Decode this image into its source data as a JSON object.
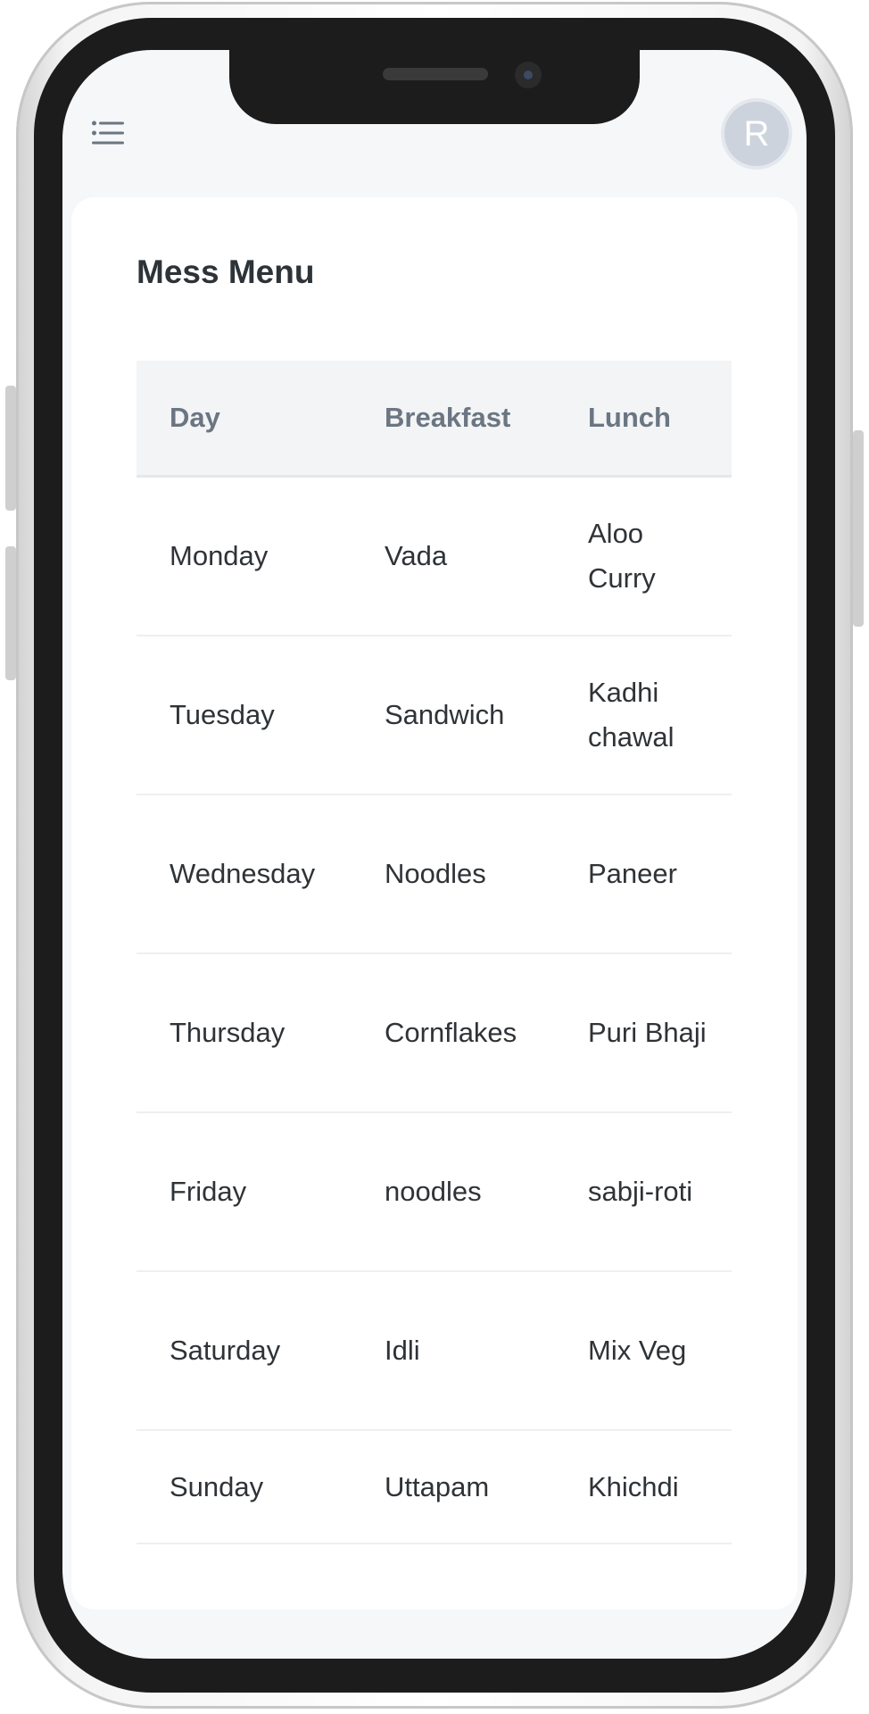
{
  "header": {
    "avatar_initial": "R"
  },
  "page": {
    "title": "Mess Menu"
  },
  "table": {
    "columns": [
      "Day",
      "Breakfast",
      "Lunch"
    ],
    "rows": [
      [
        "Monday",
        "Vada",
        "Aloo Curry"
      ],
      [
        "Tuesday",
        "Sandwich",
        "Kadhi chawal"
      ],
      [
        "Wednesday",
        "Noodles",
        "Paneer"
      ],
      [
        "Thursday",
        "Cornflakes",
        "Puri Bhaji"
      ],
      [
        "Friday",
        "noodles",
        "sabji-roti"
      ],
      [
        "Saturday",
        "Idli",
        "Mix Veg"
      ],
      [
        "Sunday",
        "Uttapam",
        "Khichdi"
      ]
    ]
  }
}
